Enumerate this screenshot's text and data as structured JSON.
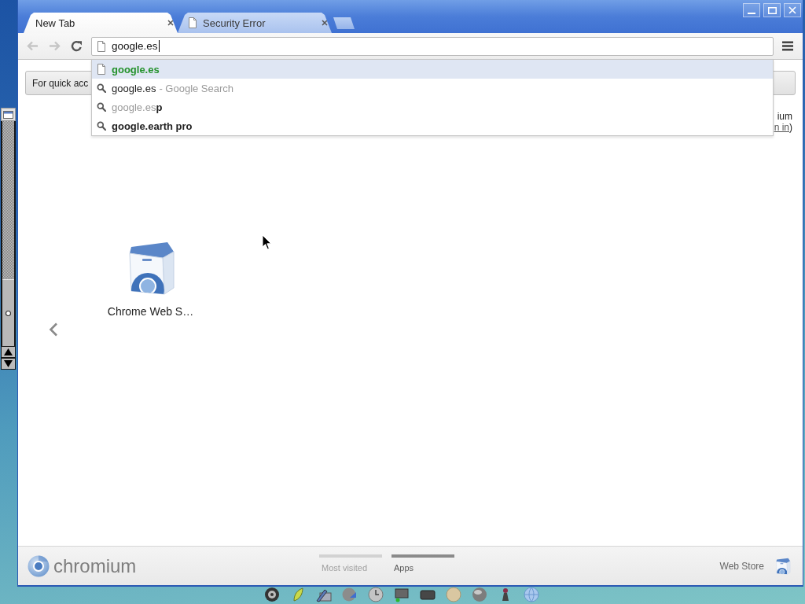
{
  "window": {
    "tabs": [
      {
        "title": "New Tab",
        "kind": "new_tab",
        "selected": true
      },
      {
        "title": "Security Error",
        "kind": "page",
        "selected": false
      }
    ]
  },
  "toolbar": {
    "back": {
      "disabled": true
    },
    "forward": {
      "disabled": true
    },
    "address": {
      "value": "google.es"
    }
  },
  "omnibox": {
    "suggestions": [
      {
        "kind": "url",
        "text": "google.es",
        "selected": true
      },
      {
        "kind": "search",
        "text": "google.es",
        "description": "- Google Search",
        "selected": false
      },
      {
        "kind": "suggest",
        "text": "google.es**p**",
        "selected": false
      },
      {
        "kind": "history",
        "text": "google.earth pro",
        "selected": false
      }
    ]
  },
  "new_tab_page": {
    "infobar": {
      "text": "For quick acc"
    },
    "sign_in_note": {
      "text": "ium",
      "link": "n in",
      "suffix": ")"
    },
    "apps": [
      {
        "label": "Chrome Web S…"
      }
    ]
  },
  "footer": {
    "brand": "chromium",
    "pages": [
      {
        "label": "Most visited",
        "selected": false
      },
      {
        "label": "Apps",
        "selected": true
      }
    ],
    "web_store": "Web Store"
  }
}
